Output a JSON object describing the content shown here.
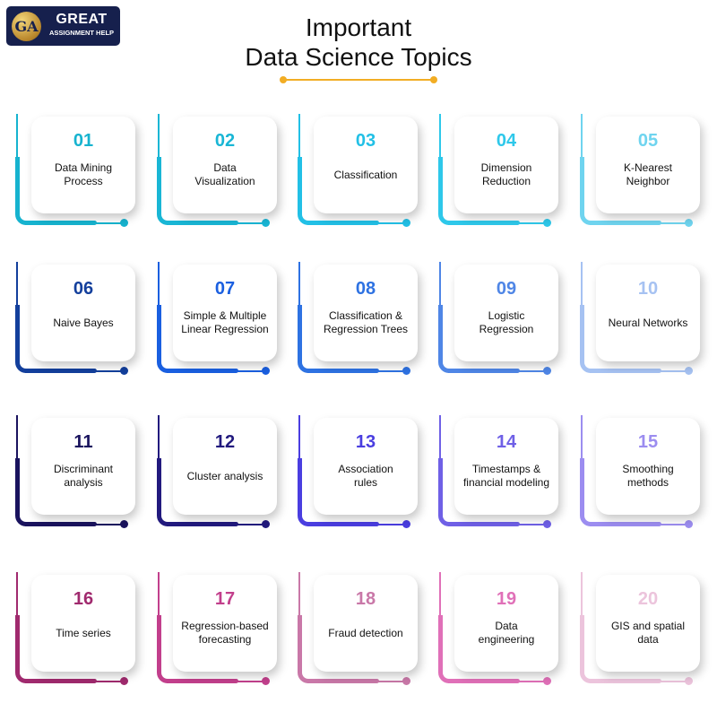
{
  "logo": {
    "mark": "GA",
    "title": "GREAT",
    "subtitle": "ASSIGNMENT HELP"
  },
  "header": {
    "title_line1": "Important",
    "title_line2": "Data Science Topics",
    "accent_color": "#f2ad24"
  },
  "topics": [
    {
      "number": "01",
      "label": "Data Mining Process",
      "color": "#16b3cf",
      "num_color": "#16b3cf"
    },
    {
      "number": "02",
      "label": "Data Visualization",
      "color": "#19b6d5",
      "num_color": "#19b6d5"
    },
    {
      "number": "03",
      "label": "Classification",
      "color": "#22c0e6",
      "num_color": "#22c0e6"
    },
    {
      "number": "04",
      "label": "Dimension Reduction",
      "color": "#2ec8ea",
      "num_color": "#2ec8ea"
    },
    {
      "number": "05",
      "label": "K-Nearest Neighbor",
      "color": "#6fd4ef",
      "num_color": "#6fd4ef"
    },
    {
      "number": "06",
      "label": "Naive Bayes",
      "color": "#133f9c",
      "num_color": "#133f9c"
    },
    {
      "number": "07",
      "label": "Simple & Multiple Linear Regression",
      "color": "#1a5fe0",
      "num_color": "#1a5fe0"
    },
    {
      "number": "08",
      "label": "Classification & Regression Trees",
      "color": "#2e72e2",
      "num_color": "#2e72e2"
    },
    {
      "number": "09",
      "label": "Logistic Regression",
      "color": "#4f86e6",
      "num_color": "#4f86e6"
    },
    {
      "number": "10",
      "label": "Neural Networks",
      "color": "#a6c2f2",
      "num_color": "#a6c2f2"
    },
    {
      "number": "11",
      "label": "Discriminant analysis",
      "color": "#1a135e",
      "num_color": "#1a135e"
    },
    {
      "number": "12",
      "label": "Cluster analysis",
      "color": "#221a7e",
      "num_color": "#221a7e"
    },
    {
      "number": "13",
      "label": "Association rules",
      "color": "#4a3ee0",
      "num_color": "#4a3ee0"
    },
    {
      "number": "14",
      "label": "Timestamps & financial modeling",
      "color": "#6f60e6",
      "num_color": "#6f60e6"
    },
    {
      "number": "15",
      "label": "Smoothing methods",
      "color": "#9c8df0",
      "num_color": "#9c8df0"
    },
    {
      "number": "16",
      "label": "Time series",
      "color": "#a02a6e",
      "num_color": "#a02a6e"
    },
    {
      "number": "17",
      "label": "Regression-based forecasting",
      "color": "#c23f8c",
      "num_color": "#c23f8c"
    },
    {
      "number": "18",
      "label": "Fraud detection",
      "color": "#c978a8",
      "num_color": "#c978a8"
    },
    {
      "number": "19",
      "label": "Data engineering",
      "color": "#e070b8",
      "num_color": "#e070b8"
    },
    {
      "number": "20",
      "label": "GIS and spatial data",
      "color": "#ecc4dc",
      "num_color": "#ecc4dc"
    }
  ]
}
